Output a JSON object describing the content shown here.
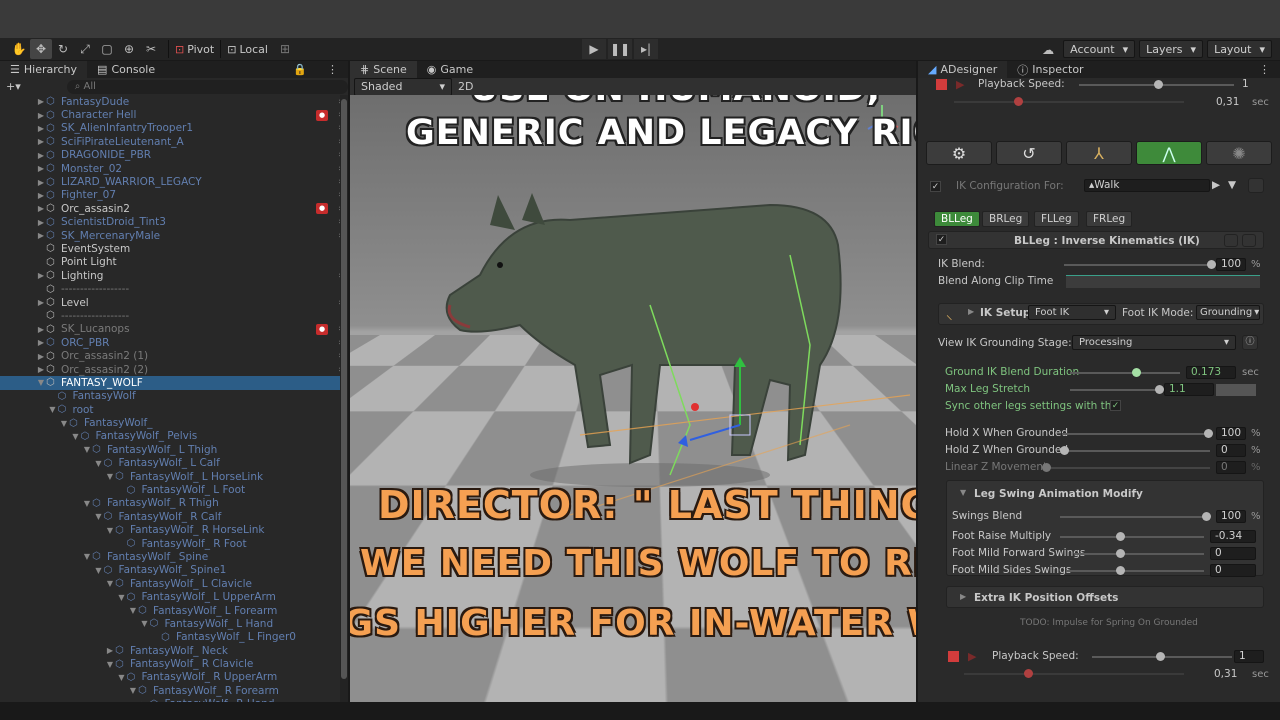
{
  "toolbar": {
    "tool_icons": [
      "hand-icon",
      "move-icon",
      "rotate-icon",
      "scale-icon",
      "rect-icon",
      "transform-icon",
      "custom-tool-icon"
    ],
    "pivot_label": "Pivot",
    "local_label": "Local",
    "account_label": "Account",
    "layers_label": "Layers",
    "layout_label": "Layout"
  },
  "hierarchy": {
    "tab_label": "Hierarchy",
    "console_label": "Console",
    "search_placeholder": "All",
    "items": [
      {
        "label": "FantasyDude",
        "style": "dim",
        "indent": 0,
        "arrow": "▶"
      },
      {
        "label": "Character Hell",
        "style": "dim",
        "indent": 0,
        "arrow": "▶",
        "badge": "red"
      },
      {
        "label": "SK_AlienInfantryTrooper1",
        "style": "dim",
        "indent": 0,
        "arrow": "▶"
      },
      {
        "label": "SciFiPirateLieutenant_A",
        "style": "dim",
        "indent": 0,
        "arrow": "▶"
      },
      {
        "label": "DRAGONIDE_PBR",
        "style": "dim",
        "indent": 0,
        "arrow": "▶"
      },
      {
        "label": "Monster_02",
        "style": "dim",
        "indent": 0,
        "arrow": "▶"
      },
      {
        "label": "LIZARD_WARRIOR_LEGACY",
        "style": "dim",
        "indent": 0,
        "arrow": "▶"
      },
      {
        "label": "Fighter_07",
        "style": "dim",
        "indent": 0,
        "arrow": "▶"
      },
      {
        "label": "Orc_assasin2",
        "style": "normal",
        "indent": 0,
        "arrow": "▶",
        "badge": "red"
      },
      {
        "label": "ScientistDroid_Tint3",
        "style": "dim",
        "indent": 0,
        "arrow": "▶"
      },
      {
        "label": "SK_MercenaryMale",
        "style": "dim",
        "indent": 0,
        "arrow": "▶"
      },
      {
        "label": "EventSystem",
        "style": "normal",
        "indent": 0,
        "arrow": ""
      },
      {
        "label": "Point Light",
        "style": "normal",
        "indent": 0,
        "arrow": ""
      },
      {
        "label": "Lighting",
        "style": "normal",
        "indent": 0,
        "arrow": "▶"
      },
      {
        "label": "------------------",
        "style": "grey",
        "indent": 0,
        "arrow": ""
      },
      {
        "label": "Level",
        "style": "normal",
        "indent": 0,
        "arrow": "▶"
      },
      {
        "label": "------------------",
        "style": "grey",
        "indent": 0,
        "arrow": ""
      },
      {
        "label": "SK_Lucanops",
        "style": "grey",
        "indent": 0,
        "arrow": "▶",
        "badge": "red"
      },
      {
        "label": "ORC_PBR",
        "style": "dim",
        "indent": 0,
        "arrow": "▶"
      },
      {
        "label": "Orc_assasin2 (1)",
        "style": "grey",
        "indent": 0,
        "arrow": "▶"
      },
      {
        "label": "Orc_assasin2 (2)",
        "style": "grey",
        "indent": 0,
        "arrow": "▶"
      },
      {
        "label": "FANTASY_WOLF",
        "style": "selrow",
        "indent": 0,
        "arrow": "▼"
      },
      {
        "label": "FantasyWolf",
        "style": "dim",
        "indent": 1,
        "arrow": ""
      },
      {
        "label": "root",
        "style": "dim",
        "indent": 1,
        "arrow": "▼"
      },
      {
        "label": "FantasyWolf_",
        "style": "dim",
        "indent": 2,
        "arrow": "▼"
      },
      {
        "label": "FantasyWolf_ Pelvis",
        "style": "dim",
        "indent": 3,
        "arrow": "▼"
      },
      {
        "label": "FantasyWolf_ L Thigh",
        "style": "dim",
        "indent": 4,
        "arrow": "▼"
      },
      {
        "label": "FantasyWolf_ L Calf",
        "style": "dim",
        "indent": 5,
        "arrow": "▼"
      },
      {
        "label": "FantasyWolf_ L HorseLink",
        "style": "dim",
        "indent": 6,
        "arrow": "▼"
      },
      {
        "label": "FantasyWolf_ L Foot",
        "style": "dim",
        "indent": 7,
        "arrow": ""
      },
      {
        "label": "FantasyWolf_ R Thigh",
        "style": "dim",
        "indent": 4,
        "arrow": "▼"
      },
      {
        "label": "FantasyWolf_ R Calf",
        "style": "dim",
        "indent": 5,
        "arrow": "▼"
      },
      {
        "label": "FantasyWolf_ R HorseLink",
        "style": "dim",
        "indent": 6,
        "arrow": "▼"
      },
      {
        "label": "FantasyWolf_ R Foot",
        "style": "dim",
        "indent": 7,
        "arrow": ""
      },
      {
        "label": "FantasyWolf_ Spine",
        "style": "dim",
        "indent": 4,
        "arrow": "▼"
      },
      {
        "label": "FantasyWolf_ Spine1",
        "style": "dim",
        "indent": 5,
        "arrow": "▼"
      },
      {
        "label": "FantasyWolf_ L Clavicle",
        "style": "dim",
        "indent": 6,
        "arrow": "▼"
      },
      {
        "label": "FantasyWolf_ L UpperArm",
        "style": "dim",
        "indent": 7,
        "arrow": "▼"
      },
      {
        "label": "FantasyWolf_ L Forearm",
        "style": "dim",
        "indent": 8,
        "arrow": "▼"
      },
      {
        "label": "FantasyWolf_ L Hand",
        "style": "dim",
        "indent": 9,
        "arrow": "▼"
      },
      {
        "label": "FantasyWolf_ L Finger0",
        "style": "dim",
        "indent": 10,
        "arrow": ""
      },
      {
        "label": "FantasyWolf_ Neck",
        "style": "dim",
        "indent": 6,
        "arrow": "▶"
      },
      {
        "label": "FantasyWolf_ R Clavicle",
        "style": "dim",
        "indent": 6,
        "arrow": "▼"
      },
      {
        "label": "FantasyWolf_ R UpperArm",
        "style": "dim",
        "indent": 7,
        "arrow": "▼"
      },
      {
        "label": "FantasyWolf_ R Forearm",
        "style": "dim",
        "indent": 8,
        "arrow": "▼"
      },
      {
        "label": "FantasyWolf_ R Hand",
        "style": "dim",
        "indent": 9,
        "arrow": "▶"
      }
    ]
  },
  "scene": {
    "scene_tab": "Scene",
    "game_tab": "Game",
    "shading_mode": "Shaded",
    "mode_2d": "2D",
    "caption_top_line1": "USE ON HUMANOID,",
    "caption_top_line2": "GENERIC AND LEGACY RIGS!",
    "caption_bottom_line1": "DIRECTOR: \" LAST THING...",
    "caption_bottom_line2": "WE NEED THIS WOLF TO RISE",
    "caption_bottom_line3": "LEGS HIGHER FOR IN-WATER WALK\""
  },
  "inspector": {
    "adesigner_tab": "ADesigner",
    "inspector_tab": "Inspector",
    "playback_speed_label": "Playback Speed:",
    "playback_speed_value": "1",
    "playback_time": "0,31",
    "playback_unit": "sec",
    "mode_icons": [
      "gear-icon",
      "refresh-icon",
      "axis-icon",
      "ik-leg-icon",
      "sparkle-icon"
    ],
    "ik_config_label": "IK Configuration For:",
    "ik_config_value": "Walk",
    "leg_tabs": [
      "BLLeg",
      "BRLeg",
      "FLLeg",
      "FRLeg"
    ],
    "section_title": "BLLeg : Inverse Kinematics (IK)",
    "ik_blend_label": "IK Blend:",
    "ik_blend_value": "100",
    "blend_along_label": "Blend Along Clip Time",
    "ik_setup_label": "IK Setup",
    "ik_setup_value": "Foot IK",
    "foot_ik_mode_label": "Foot IK Mode:",
    "foot_ik_mode_value": "Grounding",
    "view_stage_label": "View IK Grounding Stage:",
    "view_stage_value": "Processing",
    "ground_blend_label": "Ground IK Blend Duration",
    "ground_blend_value": "0.173",
    "max_stretch_label": "Max Leg Stretch",
    "max_stretch_value": "1.1",
    "sync_label": "Sync other legs settings with this",
    "hold_x_label": "Hold X When Grounded",
    "hold_x_value": "100",
    "hold_z_label": "Hold Z When Grounded",
    "hold_z_value": "0",
    "linear_z_label": "Linear Z Movement",
    "linear_z_value": "0",
    "swing_section": "Leg Swing Animation Modify",
    "swings_blend_label": "Swings Blend",
    "swings_blend_value": "100",
    "foot_raise_label": "Foot Raise Multiply",
    "foot_raise_value": "-0.34",
    "mild_forward_label": "Foot Mild Forward Swings",
    "mild_forward_value": "0",
    "mild_sides_label": "Foot Mild Sides Swings",
    "mild_sides_value": "0",
    "extra_offsets_label": "Extra IK Position Offsets",
    "todo_label": "TODO: Impulse for Spring On Grounded",
    "playback2_label": "Playback Speed:",
    "playback2_value": "1",
    "playback2_time": "0,31",
    "percent": "%",
    "sec": "sec"
  }
}
